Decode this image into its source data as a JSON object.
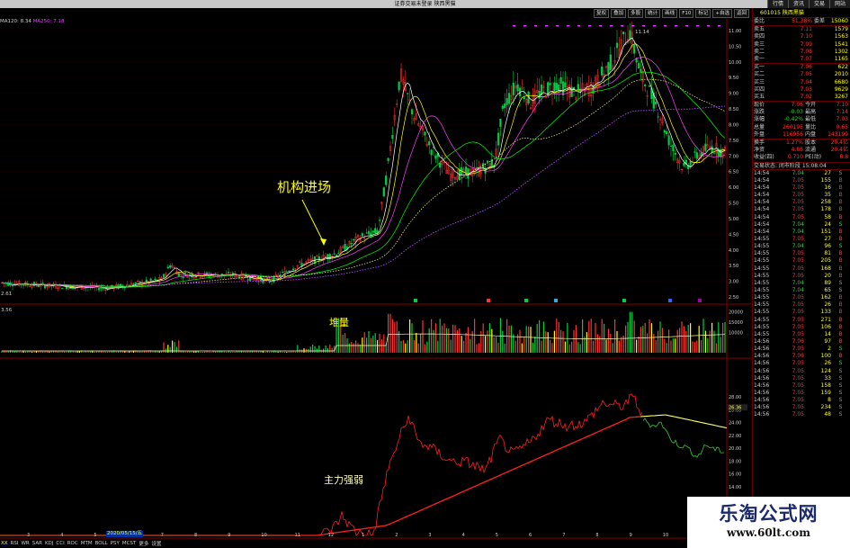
{
  "titlebar": {
    "title": "证券交易未登录  陕西黑猫"
  },
  "top_menu": [
    "行情",
    "资讯",
    "交易",
    "网站"
  ],
  "toolbar": [
    "复权",
    "叠加",
    "多股",
    "统计",
    "画线",
    "F10",
    "标记",
    "+自选",
    "返回"
  ],
  "ma_legend": {
    "ma120": "MA120: 8.34",
    "ma250": "MA250: 7.18"
  },
  "price_axis": [
    "11.00",
    "10.50",
    "10.00",
    "9.50",
    "9.00",
    "8.50",
    "8.00",
    "7.50",
    "7.00",
    "6.50",
    "6.00",
    "5.50",
    "5.00",
    "4.50",
    "4.00",
    "3.50",
    "3.00",
    "2.50"
  ],
  "price_labels": {
    "high": "11.14",
    "low": "2.61"
  },
  "volume_axis": [
    "20000",
    "15000",
    "10000"
  ],
  "volume_label": "3.56",
  "indicator_axis": [
    "28.00",
    "26.00",
    "24.00",
    "22.00",
    "20.00",
    "18.00",
    "16.00",
    "14.00"
  ],
  "indicator_value": "26.36",
  "annotations": {
    "institution": "机构进场",
    "volume_stack": "堆量",
    "main_force": "主力强弱"
  },
  "xaxis": [
    "3",
    "4",
    "5",
    "6",
    "7",
    "8",
    "9",
    "10",
    "11",
    "12",
    "1",
    "2",
    "3",
    "4",
    "5",
    "6",
    "7",
    "8",
    "9",
    "10",
    "11"
  ],
  "date_box": "2020/05/15/五",
  "bottom_tabs": [
    "XX",
    "RSI",
    "WR",
    "SAR",
    "KDJ",
    "CCI",
    "ROC",
    "MTM",
    "BOLL",
    "PSY",
    "MCST",
    "更多",
    "设置"
  ],
  "stock": {
    "code": "601015",
    "name": "陕西黑猫"
  },
  "order_book": {
    "header": {
      "label": "委比",
      "ratio": "51.38%",
      "label2": "委差",
      "diff": "15060"
    },
    "asks": [
      {
        "label": "卖五",
        "price": "7.11",
        "vol": "1579"
      },
      {
        "label": "卖四",
        "price": "7.10",
        "vol": "1563"
      },
      {
        "label": "卖三",
        "price": "7.09",
        "vol": "1541"
      },
      {
        "label": "卖二",
        "price": "7.08",
        "vol": "1302"
      },
      {
        "label": "卖一",
        "price": "7.07",
        "vol": "1165"
      }
    ],
    "bids": [
      {
        "label": "买一",
        "price": "7.06",
        "vol": "622"
      },
      {
        "label": "买二",
        "price": "7.05",
        "vol": "2010"
      },
      {
        "label": "买三",
        "price": "7.04",
        "vol": "6680"
      },
      {
        "label": "买四",
        "price": "7.03",
        "vol": "9629"
      },
      {
        "label": "买五",
        "price": "7.02",
        "vol": "3267"
      }
    ]
  },
  "quote": [
    {
      "l1": "现价",
      "v1": "7.06",
      "l2": "今开",
      "v2": "7.10"
    },
    {
      "l1": "涨跌",
      "v1": "-0.03",
      "l2": "最高",
      "v2": "7.14"
    },
    {
      "l1": "涨幅",
      "v1": "-0.42%",
      "l2": "最低",
      "v2": "7.03"
    },
    {
      "l1": "总量",
      "v1": "260195",
      "l2": "量比",
      "v2": "0.65"
    },
    {
      "l1": "外盘",
      "v1": "116956",
      "l2": "内盘",
      "v2": "143199"
    }
  ],
  "quote2": [
    {
      "l1": "换手",
      "v1": "1.27%",
      "l2": "股本",
      "v2": "20.4亿"
    },
    {
      "l1": "净资",
      "v1": "4.86",
      "l2": "流通",
      "v2": "20.4亿"
    },
    {
      "l1": "收益(四)",
      "v1": "0.710",
      "l2": "PE(动)",
      "v2": "8.8"
    }
  ],
  "trade_status": "交易状态: 闭市阶段 15:08:04",
  "ticks": [
    {
      "t": "14:54",
      "p": "7.04",
      "v": "27",
      "s": "S"
    },
    {
      "t": "14:54",
      "p": "7.05",
      "v": "155",
      "s": "B"
    },
    {
      "t": "14:54",
      "p": "7.05",
      "v": "16",
      "s": "B"
    },
    {
      "t": "14:54",
      "p": "7.05",
      "v": "35",
      "s": "B"
    },
    {
      "t": "14:54",
      "p": "7.05",
      "v": "258",
      "s": "B"
    },
    {
      "t": "14:54",
      "p": "7.05",
      "v": "178",
      "s": "B"
    },
    {
      "t": "14:54",
      "p": "7.05",
      "v": "58",
      "s": "B"
    },
    {
      "t": "14:54",
      "p": "7.04",
      "v": "24",
      "s": "S"
    },
    {
      "t": "14:54",
      "p": "7.04",
      "v": "151",
      "s": "B"
    },
    {
      "t": "14:55",
      "p": "7.05",
      "v": "27",
      "s": "B"
    },
    {
      "t": "14:55",
      "p": "7.04",
      "v": "96",
      "s": "S"
    },
    {
      "t": "14:55",
      "p": "7.05",
      "v": "81",
      "s": "B"
    },
    {
      "t": "14:55",
      "p": "7.05",
      "v": "205",
      "s": "B"
    },
    {
      "t": "14:55",
      "p": "7.05",
      "v": "168",
      "s": "B"
    },
    {
      "t": "14:55",
      "p": "7.05",
      "v": "20",
      "s": "B"
    },
    {
      "t": "14:55",
      "p": "7.04",
      "v": "89",
      "s": "S"
    },
    {
      "t": "14:55",
      "p": "7.04",
      "v": "65",
      "s": "S"
    },
    {
      "t": "14:55",
      "p": "7.05",
      "v": "162",
      "s": "B"
    },
    {
      "t": "14:55",
      "p": "7.05",
      "v": "26",
      "s": "B"
    },
    {
      "t": "14:55",
      "p": "7.05",
      "v": "133",
      "s": "B"
    },
    {
      "t": "14:55",
      "p": "7.05",
      "v": "271",
      "s": "B"
    },
    {
      "t": "14:55",
      "p": "7.05",
      "v": "106",
      "s": "B"
    },
    {
      "t": "14:55",
      "p": "7.05",
      "v": "14",
      "s": "B"
    },
    {
      "t": "14:56",
      "p": "7.06",
      "v": "97",
      "s": "B"
    },
    {
      "t": "14:56",
      "p": "7.05",
      "v": "2",
      "s": "S"
    },
    {
      "t": "14:56",
      "p": "7.06",
      "v": "100",
      "s": "B"
    },
    {
      "t": "14:56",
      "p": "7.05",
      "v": "26",
      "s": "S"
    },
    {
      "t": "14:56",
      "p": "7.05",
      "v": "124",
      "s": "S"
    },
    {
      "t": "14:56",
      "p": "7.05",
      "v": "33",
      "s": "S"
    },
    {
      "t": "14:56",
      "p": "7.05",
      "v": "158",
      "s": "S"
    },
    {
      "t": "14:56",
      "p": "7.05",
      "v": "159",
      "s": "S"
    },
    {
      "t": "14:56",
      "p": "7.05",
      "v": "8",
      "s": "S"
    },
    {
      "t": "14:56",
      "p": "7.05",
      "v": "234",
      "s": "S"
    },
    {
      "t": "14:56",
      "p": "7.05",
      "v": "48",
      "s": "S"
    }
  ],
  "watermark": {
    "name": "乐淘公式网",
    "url": "www.60lt.com"
  },
  "colors": {
    "up": "#ff3333",
    "down": "#00cc44",
    "ma_yellow": "#ffff00",
    "ma_purple": "#b040ff",
    "ma_white": "#ffffff",
    "indicator_red": "#ff2020",
    "indicator_green": "#33cc33",
    "indicator_yellow": "#ffff66"
  }
}
